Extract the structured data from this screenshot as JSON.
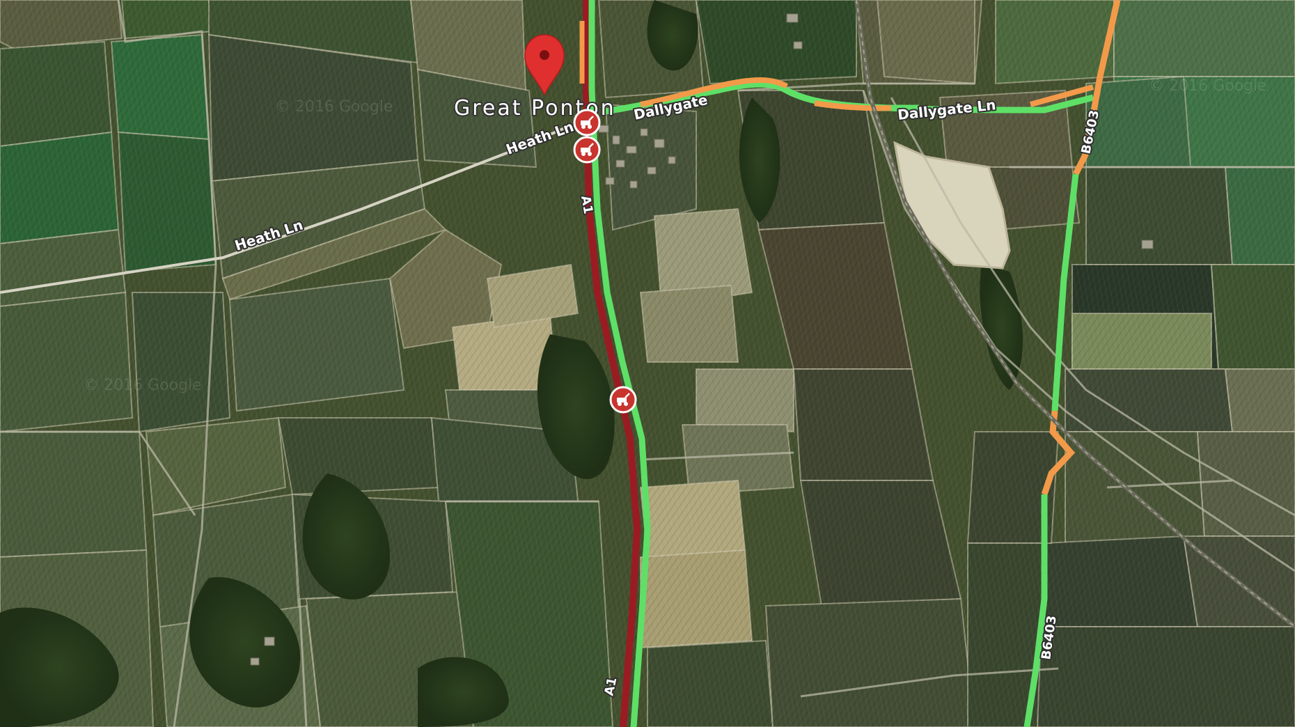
{
  "map": {
    "type": "satellite",
    "place": {
      "name": "Great Ponton"
    },
    "pin": {
      "icon": "location-pin-icon",
      "color": "#e02f2f"
    },
    "roads": {
      "heath_ln_north": "Heath Ln",
      "heath_ln_south": "Heath Ln",
      "dallygate": "Dallygate",
      "dallygate_ln": "Dallygate Ln",
      "a1_north": "A1",
      "a1_south": "A1",
      "b6403_north": "B6403",
      "b6403_south": "B6403"
    },
    "traffic_colors": {
      "free_flow": "#5ee067",
      "slow": "#f29a4a",
      "heavy": "#9a1c22"
    },
    "incidents": [
      {
        "icon": "roadworks-icon"
      },
      {
        "icon": "roadworks-icon"
      },
      {
        "icon": "roadworks-icon"
      }
    ],
    "watermark": "© 2016 Google"
  }
}
